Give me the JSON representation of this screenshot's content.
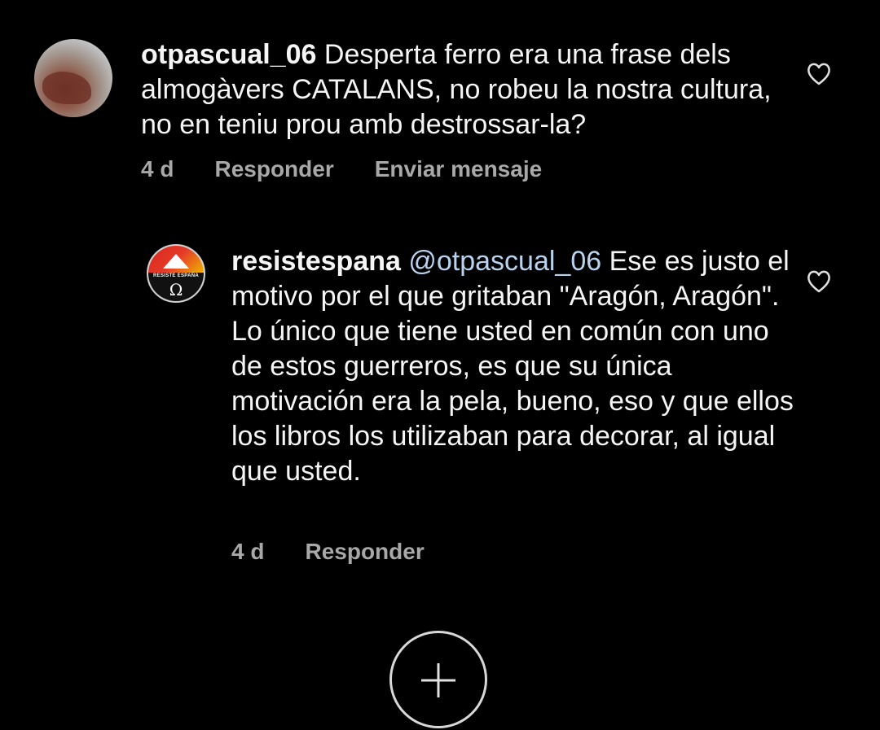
{
  "comments": [
    {
      "username": "otpascual_06",
      "text": " Desperta ferro era una frase dels almogàvers CATALANS, no robeu la nostra cultura, no en teniu prou amb destrossar-la?",
      "age": "4 d",
      "reply_label": "Responder",
      "message_label": "Enviar mensaje"
    },
    {
      "username": "resistespana",
      "mention": " @otpascual_06",
      "text": " Ese es justo el motivo por el que gritaban \"Aragón, Aragón\". Lo único que tiene usted en común con uno de estos guerreros, es que su única motivación era la pela, bueno, eso y que ellos los libros los utilizaban para decorar, al igual que usted.",
      "age": "4 d",
      "reply_label": "Responder",
      "avatar_band": "RESISTE ESPAÑA",
      "avatar_symbol": "Ω"
    }
  ],
  "colors": {
    "background": "#000000",
    "text": "#f5f5f5",
    "meta": "#a8a8a8",
    "mention": "#b9d3ee"
  },
  "icons": {
    "like": "heart-icon",
    "add": "plus-icon"
  }
}
